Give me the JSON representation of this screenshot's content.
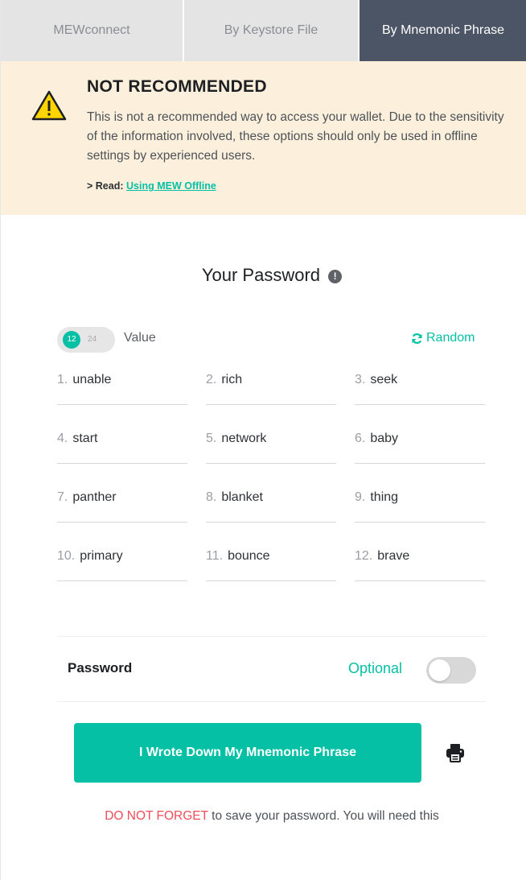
{
  "tabs": [
    {
      "label": "MEWconnect",
      "active": false
    },
    {
      "label": "By Keystore File",
      "active": false
    },
    {
      "label": "By Mnemonic Phrase",
      "active": true
    }
  ],
  "warning": {
    "icon": "warning-triangle-icon",
    "title": "NOT RECOMMENDED",
    "text": "This is not a recommended way to access your wallet. Due to the sensitivity of the information involved, these options should only be used in offline settings by experienced users.",
    "read_prefix": "> Read:",
    "read_link": "Using MEW Offline"
  },
  "mnemonic": {
    "title": "Your Password",
    "info_icon": "info-icon",
    "length_option_selected": "12",
    "length_option_other": "24",
    "value_label": "Value",
    "random_label": "Random",
    "random_icon": "refresh-icon",
    "words": [
      {
        "num": "1.",
        "word": "unable"
      },
      {
        "num": "2.",
        "word": "rich"
      },
      {
        "num": "3.",
        "word": "seek"
      },
      {
        "num": "4.",
        "word": "start"
      },
      {
        "num": "5.",
        "word": "network"
      },
      {
        "num": "6.",
        "word": "baby"
      },
      {
        "num": "7.",
        "word": "panther"
      },
      {
        "num": "8.",
        "word": "blanket"
      },
      {
        "num": "9.",
        "word": "thing"
      },
      {
        "num": "10.",
        "word": "primary"
      },
      {
        "num": "11.",
        "word": "bounce"
      },
      {
        "num": "12.",
        "word": "brave"
      }
    ]
  },
  "password_row": {
    "label": "Password",
    "optional": "Optional",
    "toggle_on": false
  },
  "actions": {
    "confirm_button": "I Wrote Down My Mnemonic Phrase",
    "print_icon": "printer-icon"
  },
  "footer": {
    "warning_emphasis": "DO NOT FORGET",
    "warning_rest": " to save your password. You will need this"
  },
  "colors": {
    "accent": "#05c0a5",
    "active_tab": "#4c5566",
    "warning_bg": "#fcf0dc",
    "alert_red": "#ef4d58"
  }
}
